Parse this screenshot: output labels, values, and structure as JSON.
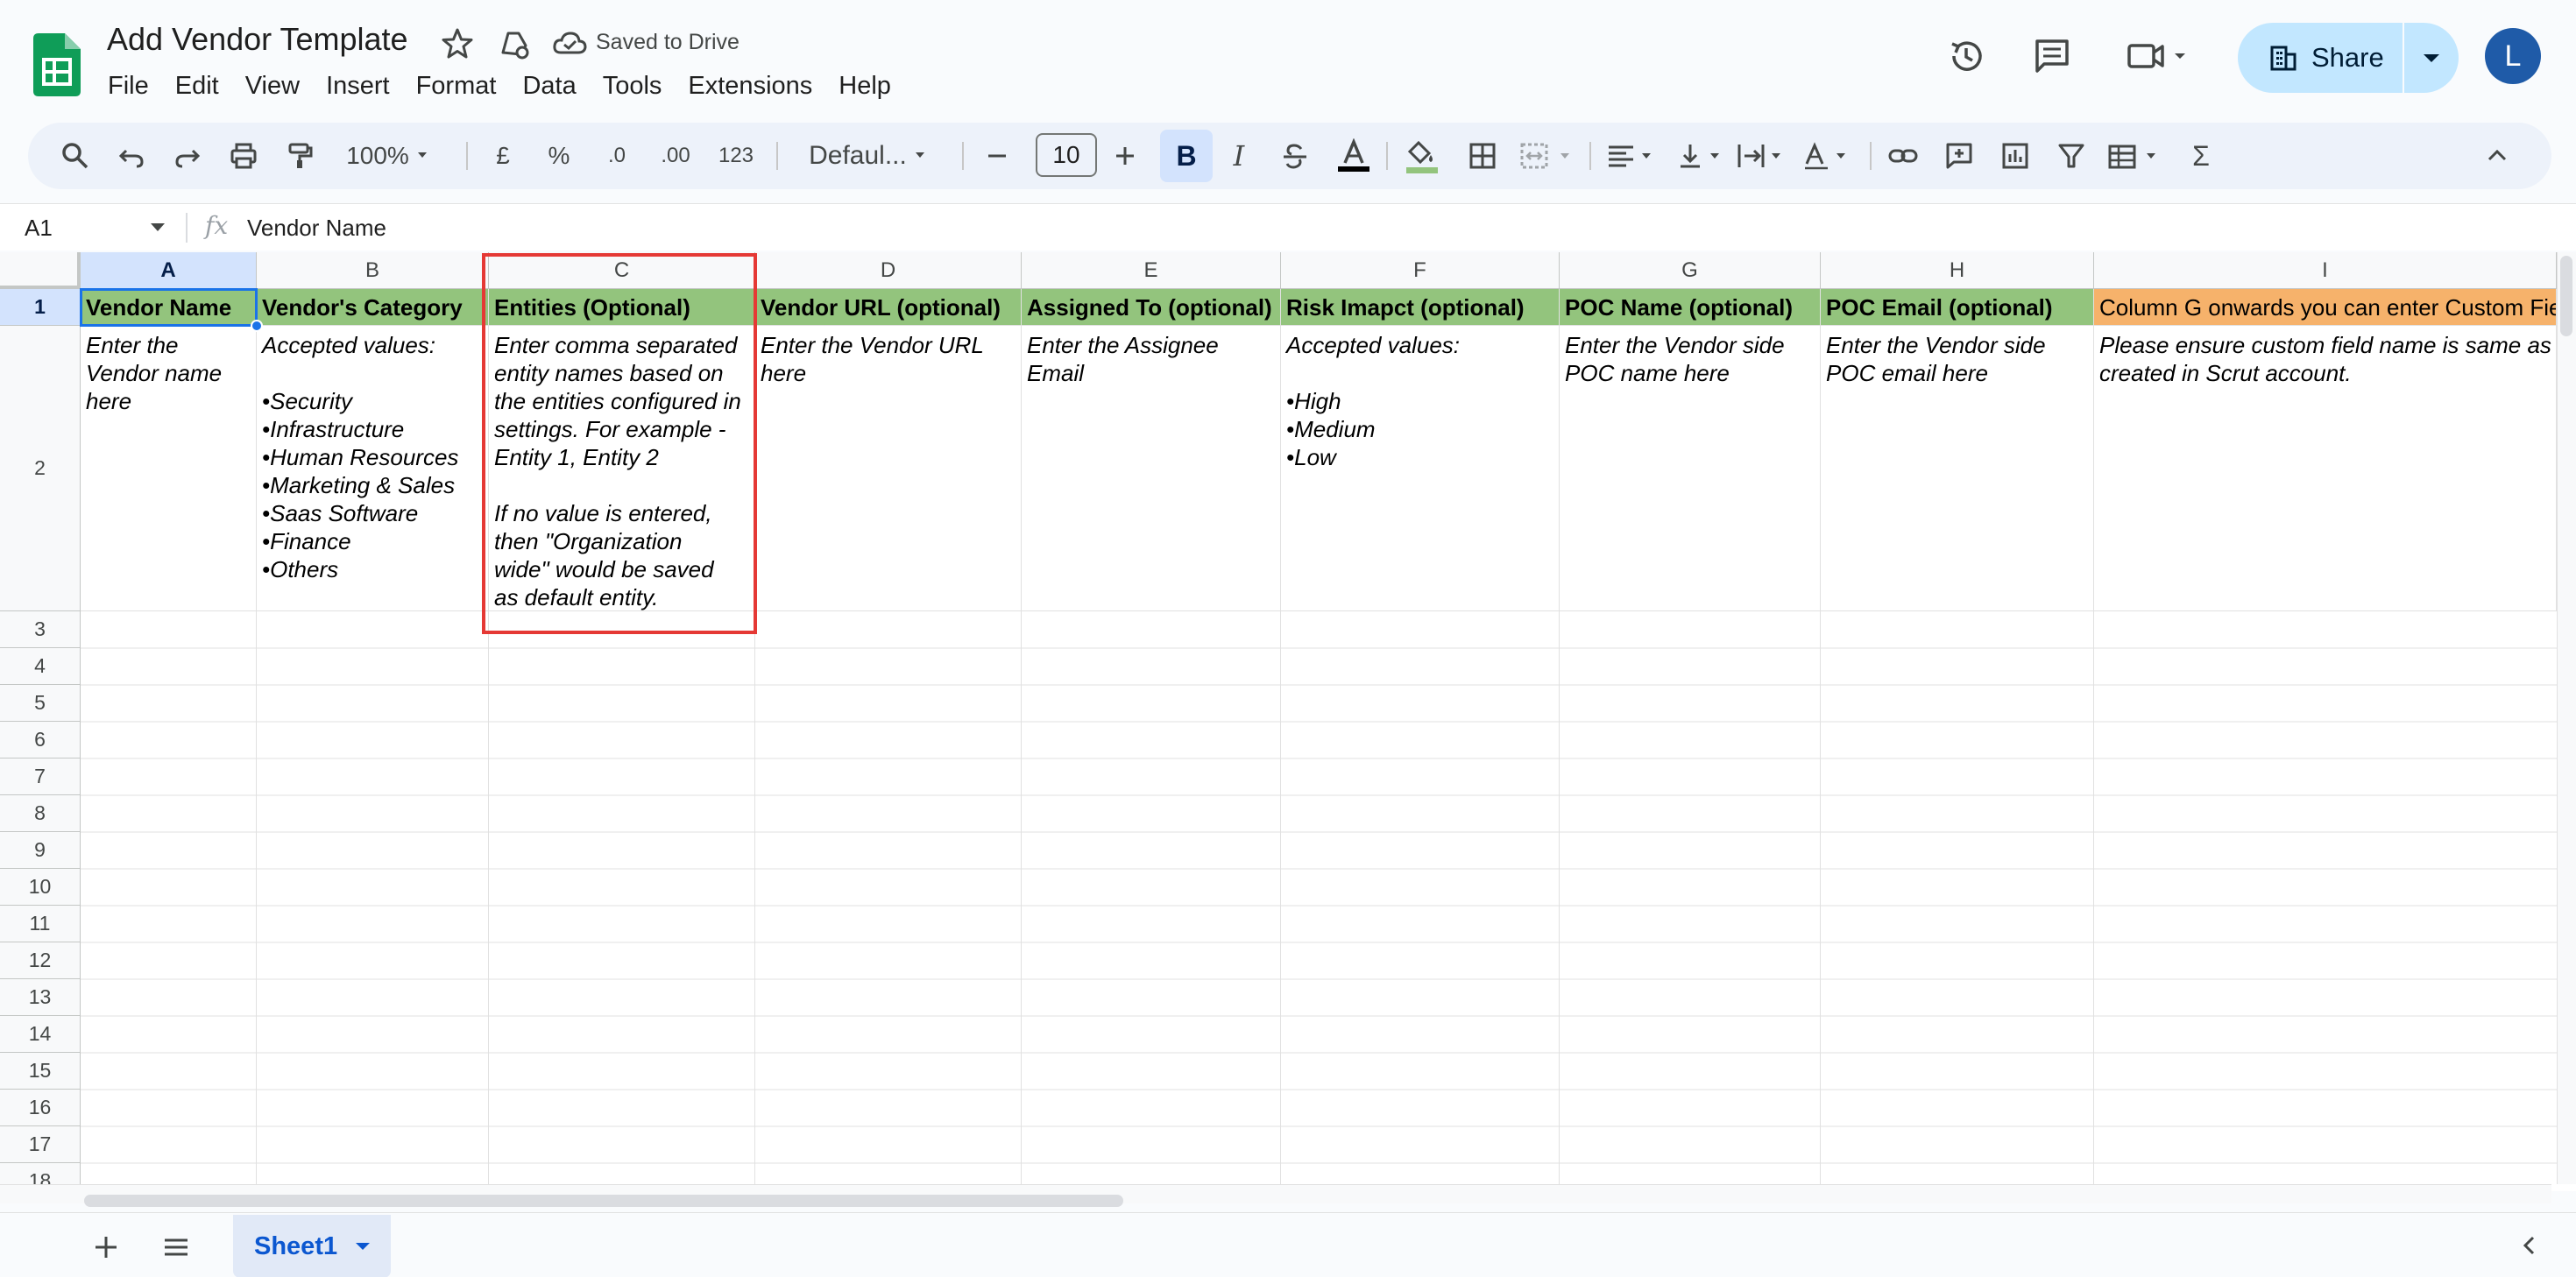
{
  "app": {
    "doc_title": "Add Vendor Template",
    "save_status": "Saved to Drive",
    "user_initial": "L",
    "share_label": "Share"
  },
  "menu": [
    "File",
    "Edit",
    "View",
    "Insert",
    "Format",
    "Data",
    "Tools",
    "Extensions",
    "Help"
  ],
  "toolbar": {
    "zoom": "100%",
    "currency": "£",
    "percent": "%",
    "decrease_decimal": ".0",
    "increase_decimal": ".00",
    "number_format": "123",
    "font": "Defaul...",
    "font_size": "10",
    "bold": "B",
    "italic": "I",
    "sum": "Σ"
  },
  "formula_bar": {
    "cell_ref": "A1",
    "fx": "fx",
    "content": "Vendor Name"
  },
  "columns": [
    "A",
    "B",
    "C",
    "D",
    "E",
    "F",
    "G",
    "H",
    "I"
  ],
  "rows": [
    "1",
    "2",
    "3",
    "4",
    "5",
    "6",
    "7",
    "8",
    "9",
    "10",
    "11",
    "12",
    "13",
    "14",
    "15",
    "16",
    "17",
    "18"
  ],
  "header_row": [
    "Vendor Name",
    "Vendor's Category",
    "Entities (Optional)",
    "Vendor URL (optional)",
    "Assigned To (optional)",
    "Risk Imapct (optional)",
    "POC Name (optional)",
    "POC Email (optional)",
    "Column G onwards you can enter Custom Fields"
  ],
  "description_row": [
    "Enter the\nVendor name\nhere",
    "Accepted values:\n\n•Security\n•Infrastructure\n•Human Resources\n•Marketing & Sales\n•Saas Software\n•Finance\n•Others",
    "Enter comma separated\nentity names based on\nthe entities configured in\nsettings. For example -\nEntity 1, Entity 2\n\nIf no value is entered,\nthen \"Organization\nwide\" would be saved\nas default entity.",
    "Enter the Vendor URL\nhere",
    "Enter the Assignee\nEmail",
    "Accepted values:\n\n•High\n•Medium\n•Low",
    "Enter the Vendor side\nPOC name here",
    "Enter the Vendor side\nPOC email here",
    "Please ensure custom field name is same as\ncreated in Scrut account."
  ],
  "sheets": [
    {
      "label": "Sheet1",
      "active": true
    }
  ],
  "colors": {
    "header_green": "#93c47d",
    "header_orange": "#f6b26b",
    "highlight_red": "#e53935",
    "selection_blue": "#1a73e8"
  }
}
